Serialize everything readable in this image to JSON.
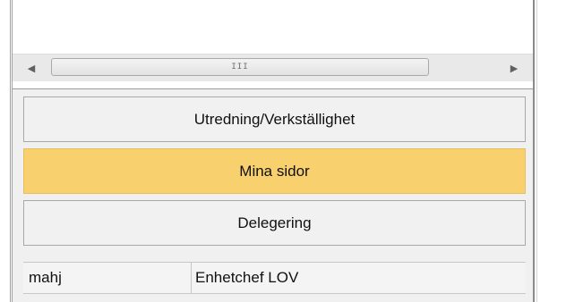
{
  "scrollbar": {
    "left_arrow": "◀",
    "right_arrow": "▶",
    "grip": "III"
  },
  "nav": {
    "items": [
      {
        "label": "Utredning/Verkställighet",
        "active": false
      },
      {
        "label": "Mina sidor",
        "active": true
      },
      {
        "label": "Delegering",
        "active": false
      }
    ]
  },
  "status": {
    "user": "mahj",
    "role": "Enhetchef LOV"
  },
  "colors": {
    "active_button": "#f8d16e",
    "panel_background": "#f0f0f0"
  }
}
